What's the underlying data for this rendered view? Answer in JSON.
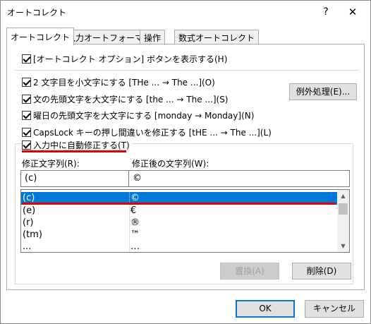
{
  "window": {
    "title": "オートコレクト",
    "help": "?",
    "close": "✕"
  },
  "tabs": [
    {
      "label": "オートコレクト"
    },
    {
      "label": "入力オートフォーマット"
    },
    {
      "label": "操作"
    },
    {
      "label": "数式オートコレクト"
    }
  ],
  "options": {
    "show_button": "[オートコレクト オプション] ボタンを表示する(H)",
    "two_initial": "2 文字目を小文字にする [THe ... → The ...](O)",
    "sentence_cap": "文の先頭文字を大文字にする [the ... → The ...](S)",
    "day_cap": "曜日の先頭文字を大文字にする [monday → Monday](N)",
    "capslock": "CapsLock キーの押し間違いを修正する [tHE ... → The ...](L)",
    "replace_typing": "入力中に自動修正する(T)"
  },
  "buttons": {
    "exceptions": "例外処理(E)...",
    "replace": "置換(A)",
    "delete": "削除(D)",
    "ok": "OK",
    "cancel": "キャンセル"
  },
  "replace_section": {
    "from_label": "修正文字列(R):",
    "to_label": "修正後の文字列(W):",
    "from_value": "(c)",
    "to_value": "©"
  },
  "list": [
    {
      "from": "(c)",
      "to": "©",
      "selected": true
    },
    {
      "from": "(e)",
      "to": "€"
    },
    {
      "from": "(r)",
      "to": "®"
    },
    {
      "from": "(tm)",
      "to": "™"
    },
    {
      "from": "...",
      "to": "…"
    }
  ],
  "colors": {
    "selection": "#0078d7",
    "annotation": "#e00000"
  }
}
